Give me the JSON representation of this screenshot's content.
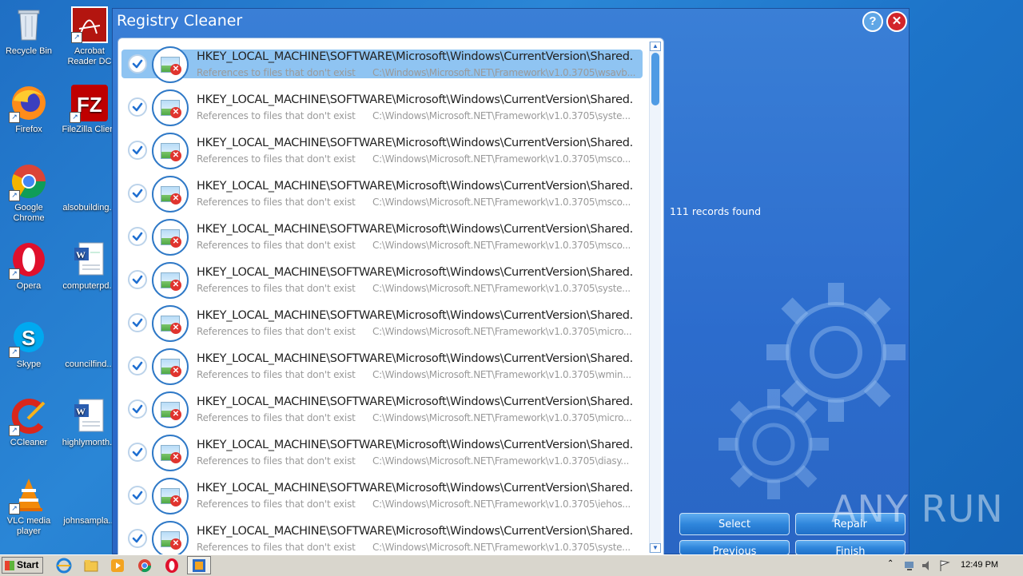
{
  "desktop": {
    "icons": [
      {
        "label": "Recycle Bin",
        "icon": "recycle-bin-icon"
      },
      {
        "label": "Acrobat Reader DC",
        "icon": "acrobat-icon"
      },
      {
        "label": "Firefox",
        "icon": "firefox-icon"
      },
      {
        "label": "FileZilla Client",
        "icon": "filezilla-icon"
      },
      {
        "label": "Google Chrome",
        "icon": "chrome-icon"
      },
      {
        "label": "alsobuilding...",
        "icon": "blank-file-icon"
      },
      {
        "label": "Opera",
        "icon": "opera-icon"
      },
      {
        "label": "computerpd...",
        "icon": "word-doc-icon"
      },
      {
        "label": "Skype",
        "icon": "skype-icon"
      },
      {
        "label": "councilfind...",
        "icon": "blank-file-icon"
      },
      {
        "label": "CCleaner",
        "icon": "ccleaner-icon"
      },
      {
        "label": "highlymonth...",
        "icon": "word-doc-icon"
      },
      {
        "label": "VLC media player",
        "icon": "vlc-icon"
      },
      {
        "label": "johnsampla...",
        "icon": "blank-file-icon"
      }
    ]
  },
  "window": {
    "title": "Registry Cleaner",
    "help_label": "?",
    "close_label": "✕",
    "records_found": "111 records found",
    "rows": [
      {
        "key": "HKEY_LOCAL_MACHINE\\SOFTWARE\\Microsoft\\Windows\\CurrentVersion\\Shared...",
        "type": "References to files that don't exist",
        "path": "C:\\Windows\\Microsoft.NET\\Framework\\v1.0.3705\\wsavb...",
        "checked": true,
        "selected": true
      },
      {
        "key": "HKEY_LOCAL_MACHINE\\SOFTWARE\\Microsoft\\Windows\\CurrentVersion\\Shared...",
        "type": "References to files that don't exist",
        "path": "C:\\Windows\\Microsoft.NET\\Framework\\v1.0.3705\\syste...",
        "checked": true,
        "selected": false
      },
      {
        "key": "HKEY_LOCAL_MACHINE\\SOFTWARE\\Microsoft\\Windows\\CurrentVersion\\Shared...",
        "type": "References to files that don't exist",
        "path": "C:\\Windows\\Microsoft.NET\\Framework\\v1.0.3705\\msco...",
        "checked": true,
        "selected": false
      },
      {
        "key": "HKEY_LOCAL_MACHINE\\SOFTWARE\\Microsoft\\Windows\\CurrentVersion\\Shared...",
        "type": "References to files that don't exist",
        "path": "C:\\Windows\\Microsoft.NET\\Framework\\v1.0.3705\\msco...",
        "checked": true,
        "selected": false
      },
      {
        "key": "HKEY_LOCAL_MACHINE\\SOFTWARE\\Microsoft\\Windows\\CurrentVersion\\Shared...",
        "type": "References to files that don't exist",
        "path": "C:\\Windows\\Microsoft.NET\\Framework\\v1.0.3705\\msco...",
        "checked": true,
        "selected": false
      },
      {
        "key": "HKEY_LOCAL_MACHINE\\SOFTWARE\\Microsoft\\Windows\\CurrentVersion\\Shared...",
        "type": "References to files that don't exist",
        "path": "C:\\Windows\\Microsoft.NET\\Framework\\v1.0.3705\\syste...",
        "checked": true,
        "selected": false
      },
      {
        "key": "HKEY_LOCAL_MACHINE\\SOFTWARE\\Microsoft\\Windows\\CurrentVersion\\Shared...",
        "type": "References to files that don't exist",
        "path": "C:\\Windows\\Microsoft.NET\\Framework\\v1.0.3705\\micro...",
        "checked": true,
        "selected": false
      },
      {
        "key": "HKEY_LOCAL_MACHINE\\SOFTWARE\\Microsoft\\Windows\\CurrentVersion\\Shared...",
        "type": "References to files that don't exist",
        "path": "C:\\Windows\\Microsoft.NET\\Framework\\v1.0.3705\\wmin...",
        "checked": true,
        "selected": false
      },
      {
        "key": "HKEY_LOCAL_MACHINE\\SOFTWARE\\Microsoft\\Windows\\CurrentVersion\\Shared...",
        "type": "References to files that don't exist",
        "path": "C:\\Windows\\Microsoft.NET\\Framework\\v1.0.3705\\micro...",
        "checked": true,
        "selected": false
      },
      {
        "key": "HKEY_LOCAL_MACHINE\\SOFTWARE\\Microsoft\\Windows\\CurrentVersion\\Shared...",
        "type": "References to files that don't exist",
        "path": "C:\\Windows\\Microsoft.NET\\Framework\\v1.0.3705\\diasy...",
        "checked": true,
        "selected": false
      },
      {
        "key": "HKEY_LOCAL_MACHINE\\SOFTWARE\\Microsoft\\Windows\\CurrentVersion\\Shared...",
        "type": "References to files that don't exist",
        "path": "C:\\Windows\\Microsoft.NET\\Framework\\v1.0.3705\\iehos...",
        "checked": true,
        "selected": false
      },
      {
        "key": "HKEY_LOCAL_MACHINE\\SOFTWARE\\Microsoft\\Windows\\CurrentVersion\\Shared...",
        "type": "References to files that don't exist",
        "path": "C:\\Windows\\Microsoft.NET\\Framework\\v1.0.3705\\syste...",
        "checked": true,
        "selected": false
      }
    ],
    "buttons": {
      "select": "Select",
      "repair": "Repair",
      "previous": "Previous",
      "finish": "Finish"
    }
  },
  "watermark": "ANY RUN",
  "taskbar": {
    "start_label": "Start",
    "clock": "12:49 PM",
    "pinned": [
      "ie-icon",
      "explorer-icon",
      "media-player-icon",
      "chrome-icon",
      "opera-icon",
      "registry-cleaner-icon"
    ]
  },
  "colors": {
    "window_bg": "#2c6ccd",
    "selected_row": "#8fc4f2",
    "button": "#2f86dc",
    "close_red": "#d2252a"
  }
}
